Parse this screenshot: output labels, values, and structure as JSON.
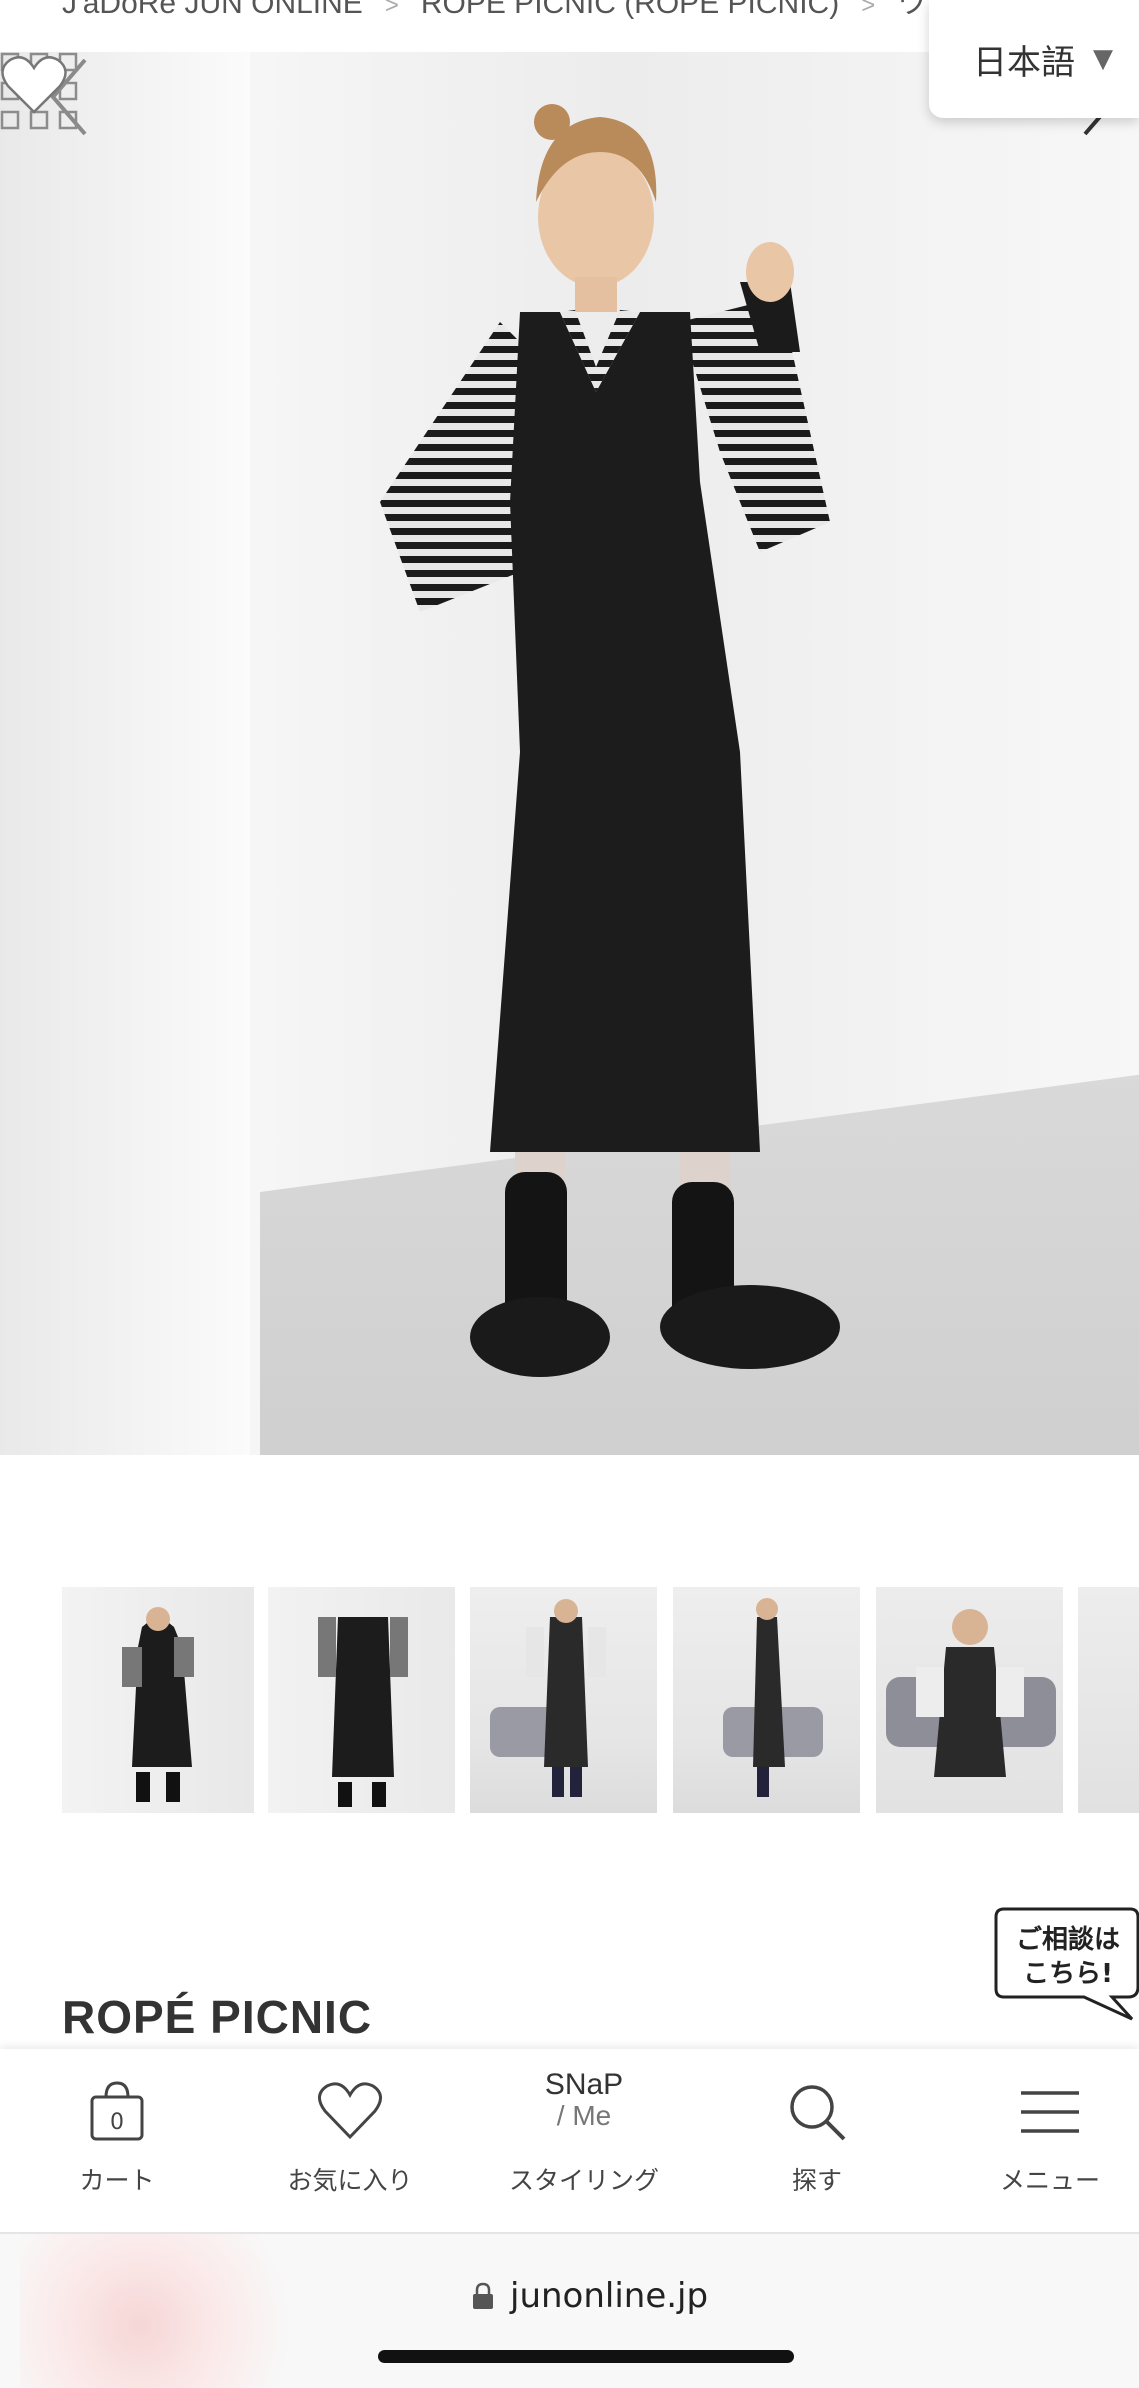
{
  "breadcrumb": {
    "items": [
      "J'aDoRe JUN ONLINE",
      "ROPÉ PICNIC (ROPÉ PICNIC)",
      "ワン"
    ],
    "separator": ">"
  },
  "language": {
    "selected": "日本語",
    "caret": "▼"
  },
  "hero": {
    "prev_icon": "chevron-left-icon",
    "next_icon": "chevron-right-icon",
    "grid_icon": "grid-icon",
    "favorite_icon": "heart-icon"
  },
  "thumbnails": [
    {
      "selected": true
    },
    {
      "selected": false
    },
    {
      "selected": false
    },
    {
      "selected": false
    },
    {
      "selected": false
    },
    {
      "selected": false
    }
  ],
  "brand": {
    "name": "ROPÉ PICNIC"
  },
  "consult": {
    "line1": "ご相談は",
    "line2": "こちら!"
  },
  "bottom_nav": {
    "cart": {
      "label": "カート",
      "count": "0"
    },
    "favorites": {
      "label": "お気に入り"
    },
    "styling": {
      "label": "スタイリング",
      "logo_top": "SNaP",
      "logo_bottom": "/ Me"
    },
    "search": {
      "label": "探す"
    },
    "menu": {
      "label": "メニュー"
    }
  },
  "browser": {
    "url": "junonline.jp"
  },
  "colors": {
    "accent": "#333333",
    "nav_text": "#444444"
  }
}
